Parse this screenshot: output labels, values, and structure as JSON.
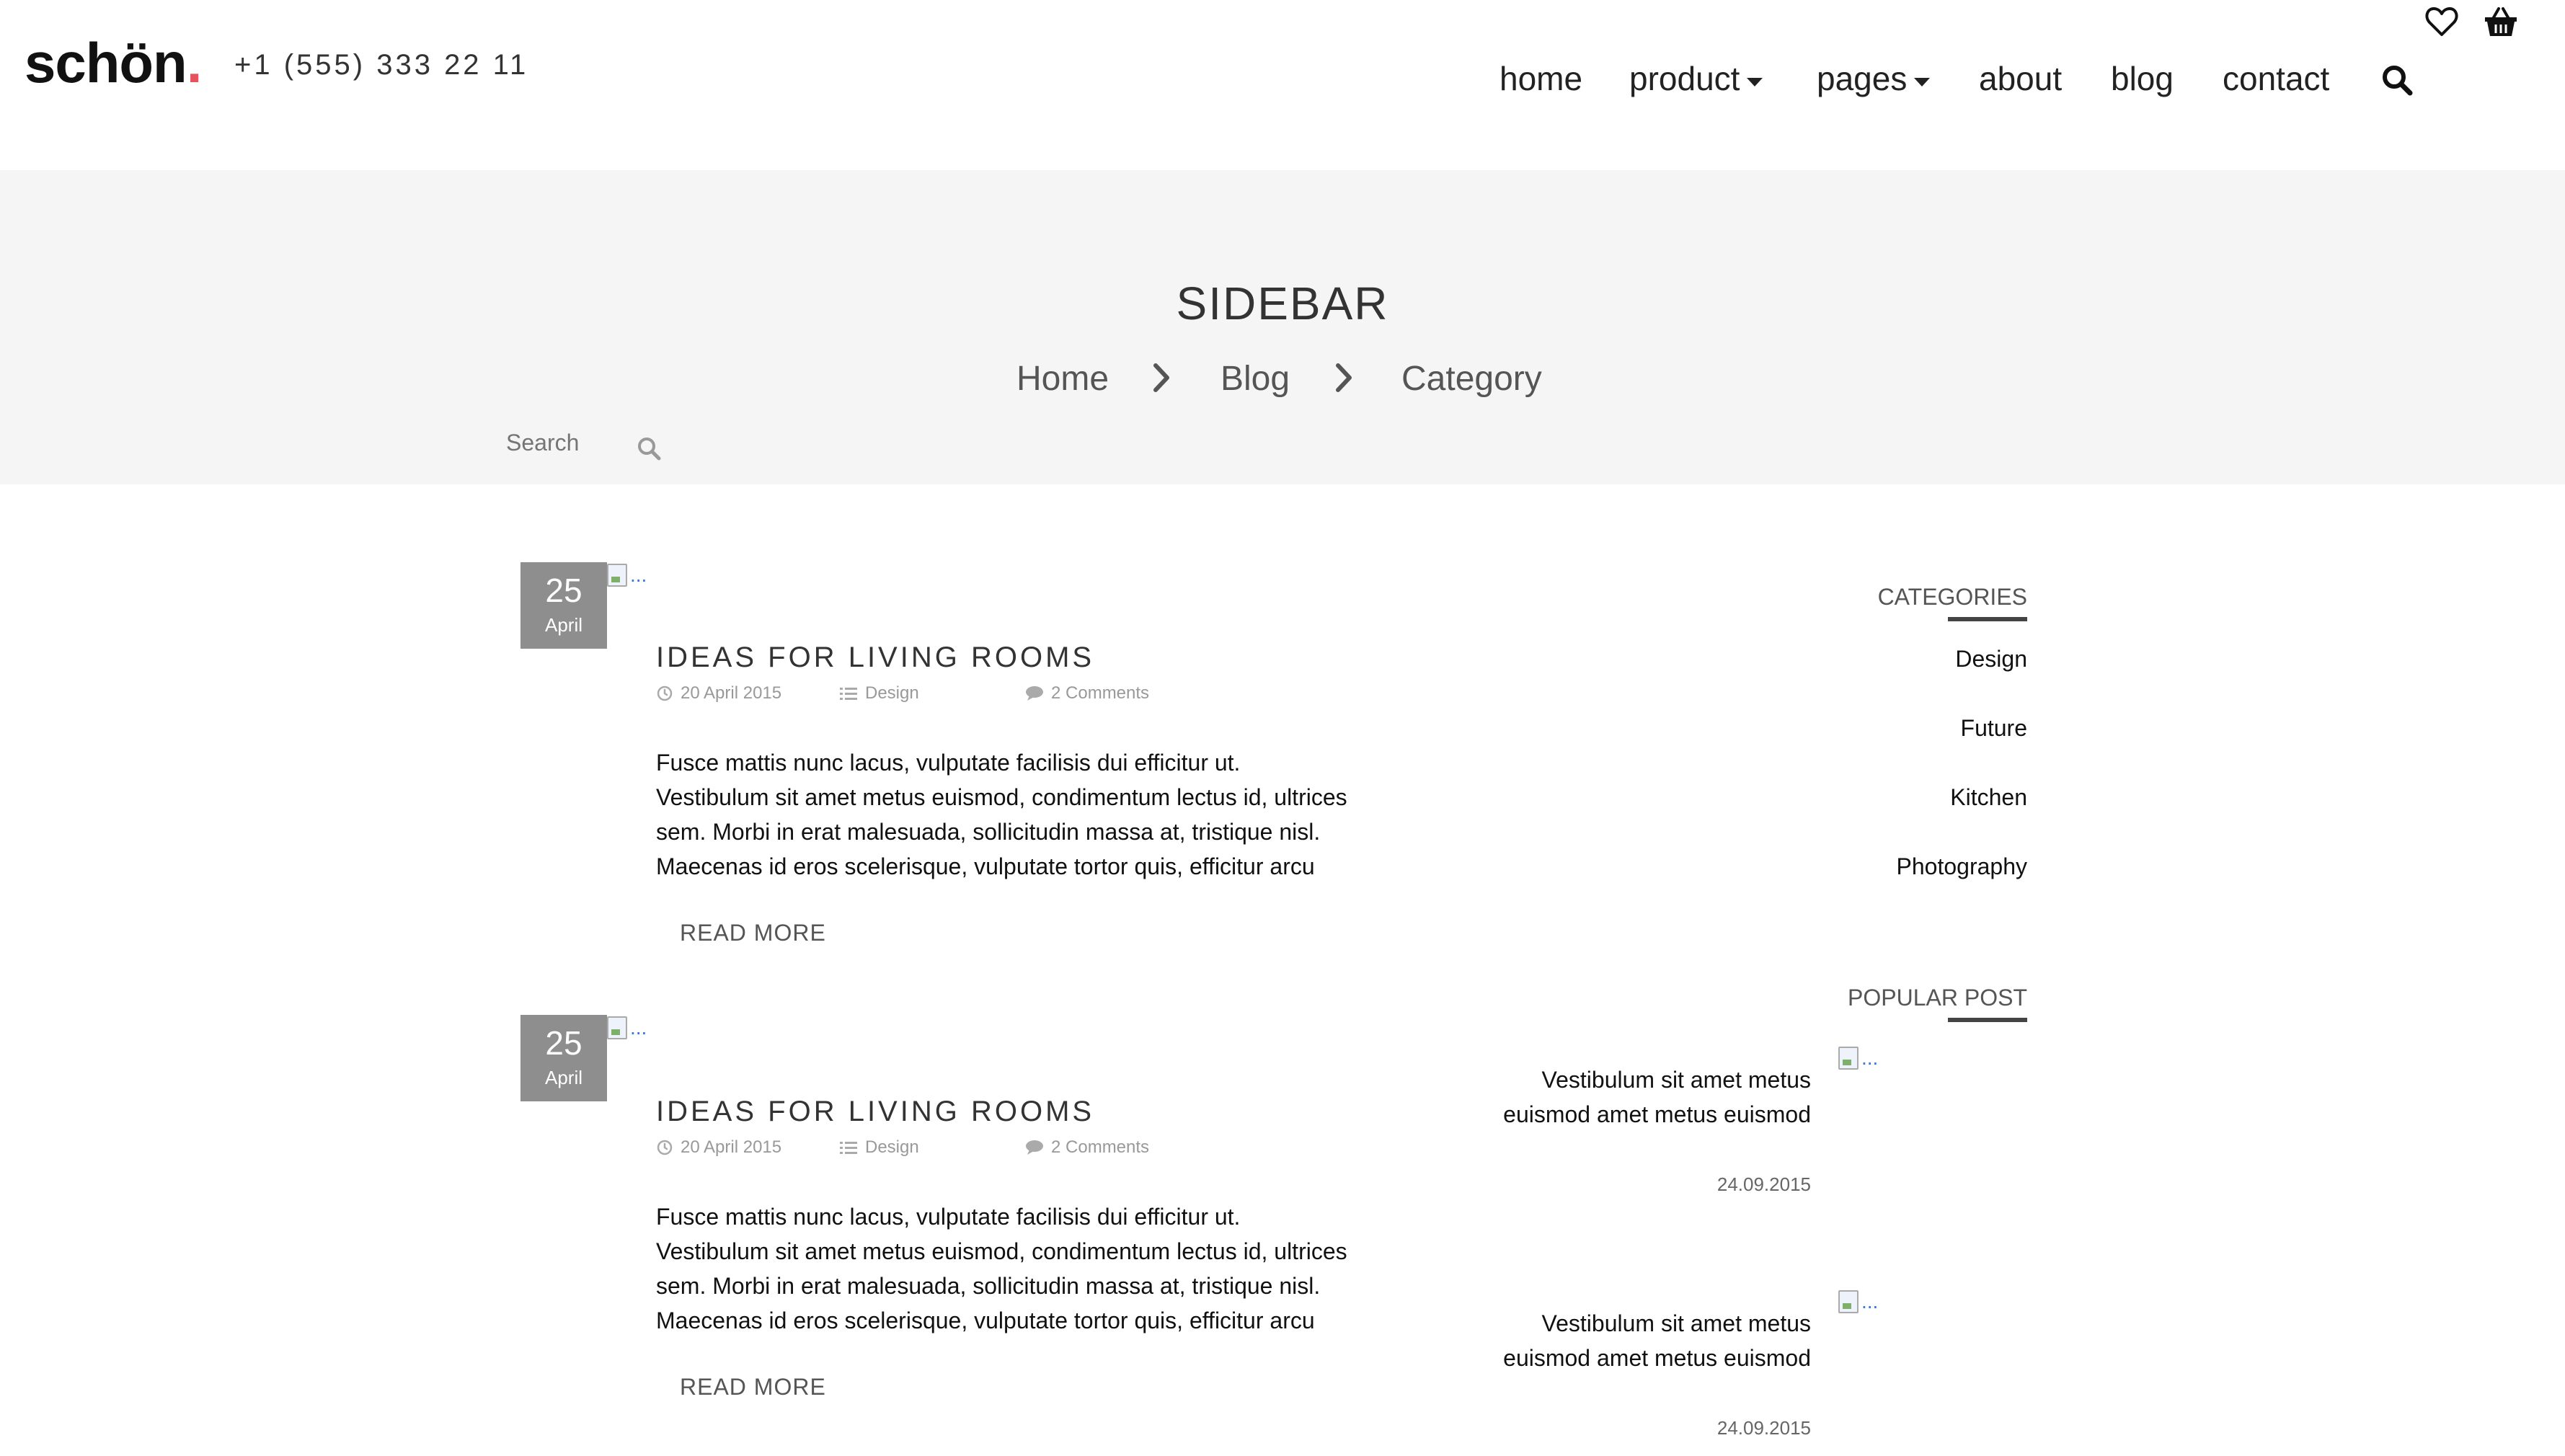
{
  "header": {
    "logo_text": "schön",
    "logo_dot": ".",
    "logo_dot_color": "#e8525c",
    "phone": "+1 (555) 333 22 11",
    "nav": [
      {
        "label": "home"
      },
      {
        "label": "product"
      },
      {
        "label": "pages"
      },
      {
        "label": "about"
      },
      {
        "label": "blog"
      },
      {
        "label": "contact"
      }
    ],
    "icons": [
      "heart-icon",
      "basket-icon",
      "search-icon"
    ]
  },
  "hero": {
    "title": "SIDEBAR",
    "breadcrumb": [
      "Home",
      "Blog",
      "Category"
    ],
    "search_placeholder": "Search"
  },
  "posts": [
    {
      "day": "25",
      "month": "April",
      "image_alt": "...",
      "title": "IDEAS FOR LIVING ROOMS",
      "date": "20 April 2015",
      "category": "Design",
      "comments": "2 Comments",
      "body": "Fusce mattis nunc lacus, vulputate facilisis dui efficitur ut. Vestibulum sit amet metus euismod, condimentum lectus id, ultrices sem. Morbi in erat malesuada, sollicitudin massa at, tristique nisl. Maecenas id eros scelerisque, vulputate tortor quis, efficitur arcu",
      "read_more": "READ MORE"
    },
    {
      "day": "25",
      "month": "April",
      "image_alt": "...",
      "title": "IDEAS FOR LIVING ROOMS",
      "date": "20 April 2015",
      "category": "Design",
      "comments": "2 Comments",
      "body": "Fusce mattis nunc lacus, vulputate facilisis dui efficitur ut. Vestibulum sit amet metus euismod, condimentum lectus id, ultrices sem. Morbi in erat malesuada, sollicitudin massa at, tristique nisl. Maecenas id eros scelerisque, vulputate tortor quis, efficitur arcu",
      "read_more": "READ MORE"
    }
  ],
  "sidebar": {
    "categories_heading": "CATEGORIES",
    "categories": [
      "Design",
      "Future",
      "Kitchen",
      "Photography"
    ],
    "popular_heading": "POPULAR POST",
    "popular": [
      {
        "title": "Vestibulum sit amet metus euismod amet metus euismod",
        "date": "24.09.2015",
        "image_alt": "..."
      },
      {
        "title": "Vestibulum sit amet metus euismod amet metus euismod",
        "date": "24.09.2015",
        "image_alt": "..."
      }
    ]
  }
}
